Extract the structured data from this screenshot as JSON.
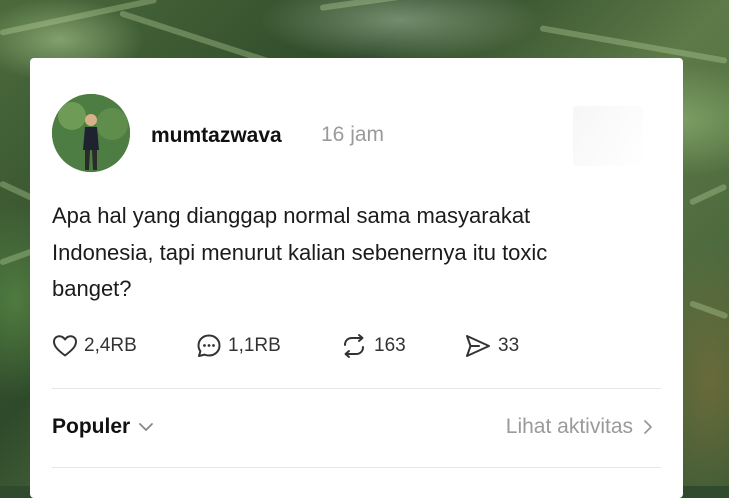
{
  "post": {
    "username": "mumtazwava",
    "time": "16 jam",
    "text": "Apa hal yang dianggap normal sama masyarakat Indonesia, tapi menurut kalian sebenernya itu toxic banget?"
  },
  "stats": {
    "likes": "2,4RB",
    "replies": "1,1RB",
    "reposts": "163",
    "shares": "33"
  },
  "footer": {
    "sort_label": "Populer",
    "activity_label": "Lihat aktivitas"
  },
  "icons": {
    "like": "heart-icon",
    "reply": "comment-icon",
    "repost": "repost-icon",
    "share": "send-icon",
    "sort": "chevron-down-icon",
    "activity": "chevron-right-icon"
  },
  "colors": {
    "card": "#ffffff",
    "text": "#111111",
    "muted": "#9a9a9a"
  }
}
